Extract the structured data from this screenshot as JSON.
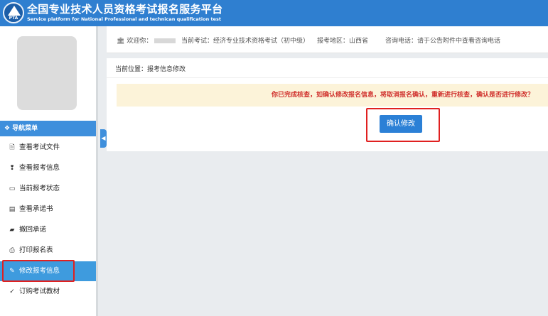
{
  "header": {
    "logo_text": "PTA",
    "title_cn": "全国专业技术人员资格考试报名服务平台",
    "title_en": "Service platform for National Professional and technican qualification test"
  },
  "topbar": {
    "welcome": "欢迎你：",
    "current_exam": "当前考试：经济专业技术资格考试（初中级）",
    "region": "报考地区：山西省",
    "phone": "咨询电话：请于公告附件中查看咨询电话"
  },
  "sidebar": {
    "nav_title": "导航菜单",
    "items": [
      {
        "label": "查看考试文件",
        "icon": "document-icon"
      },
      {
        "label": "查看报考信息",
        "icon": "info-icon"
      },
      {
        "label": "当前报考状态",
        "icon": "monitor-icon"
      },
      {
        "label": "查看承诺书",
        "icon": "id-card-icon"
      },
      {
        "label": "撤回承诺",
        "icon": "eraser-icon"
      },
      {
        "label": "打印报名表",
        "icon": "printer-icon"
      },
      {
        "label": "修改报考信息",
        "icon": "edit-icon"
      },
      {
        "label": "订购考试教材",
        "icon": "cart-icon"
      }
    ]
  },
  "main": {
    "breadcrumb": "当前位置：报考信息修改",
    "alert": "你已完成核查，如确认修改报名信息，将取消报名确认，重新进行核查，确认是否进行修改？",
    "confirm_label": "确认修改"
  },
  "colors": {
    "header_bg": "#2f7fd0",
    "nav_active": "#3e9bde",
    "alert_bg": "#fcf3d9",
    "alert_text": "#d0312d",
    "button_bg": "#2b80d6",
    "highlight": "#e02020"
  }
}
